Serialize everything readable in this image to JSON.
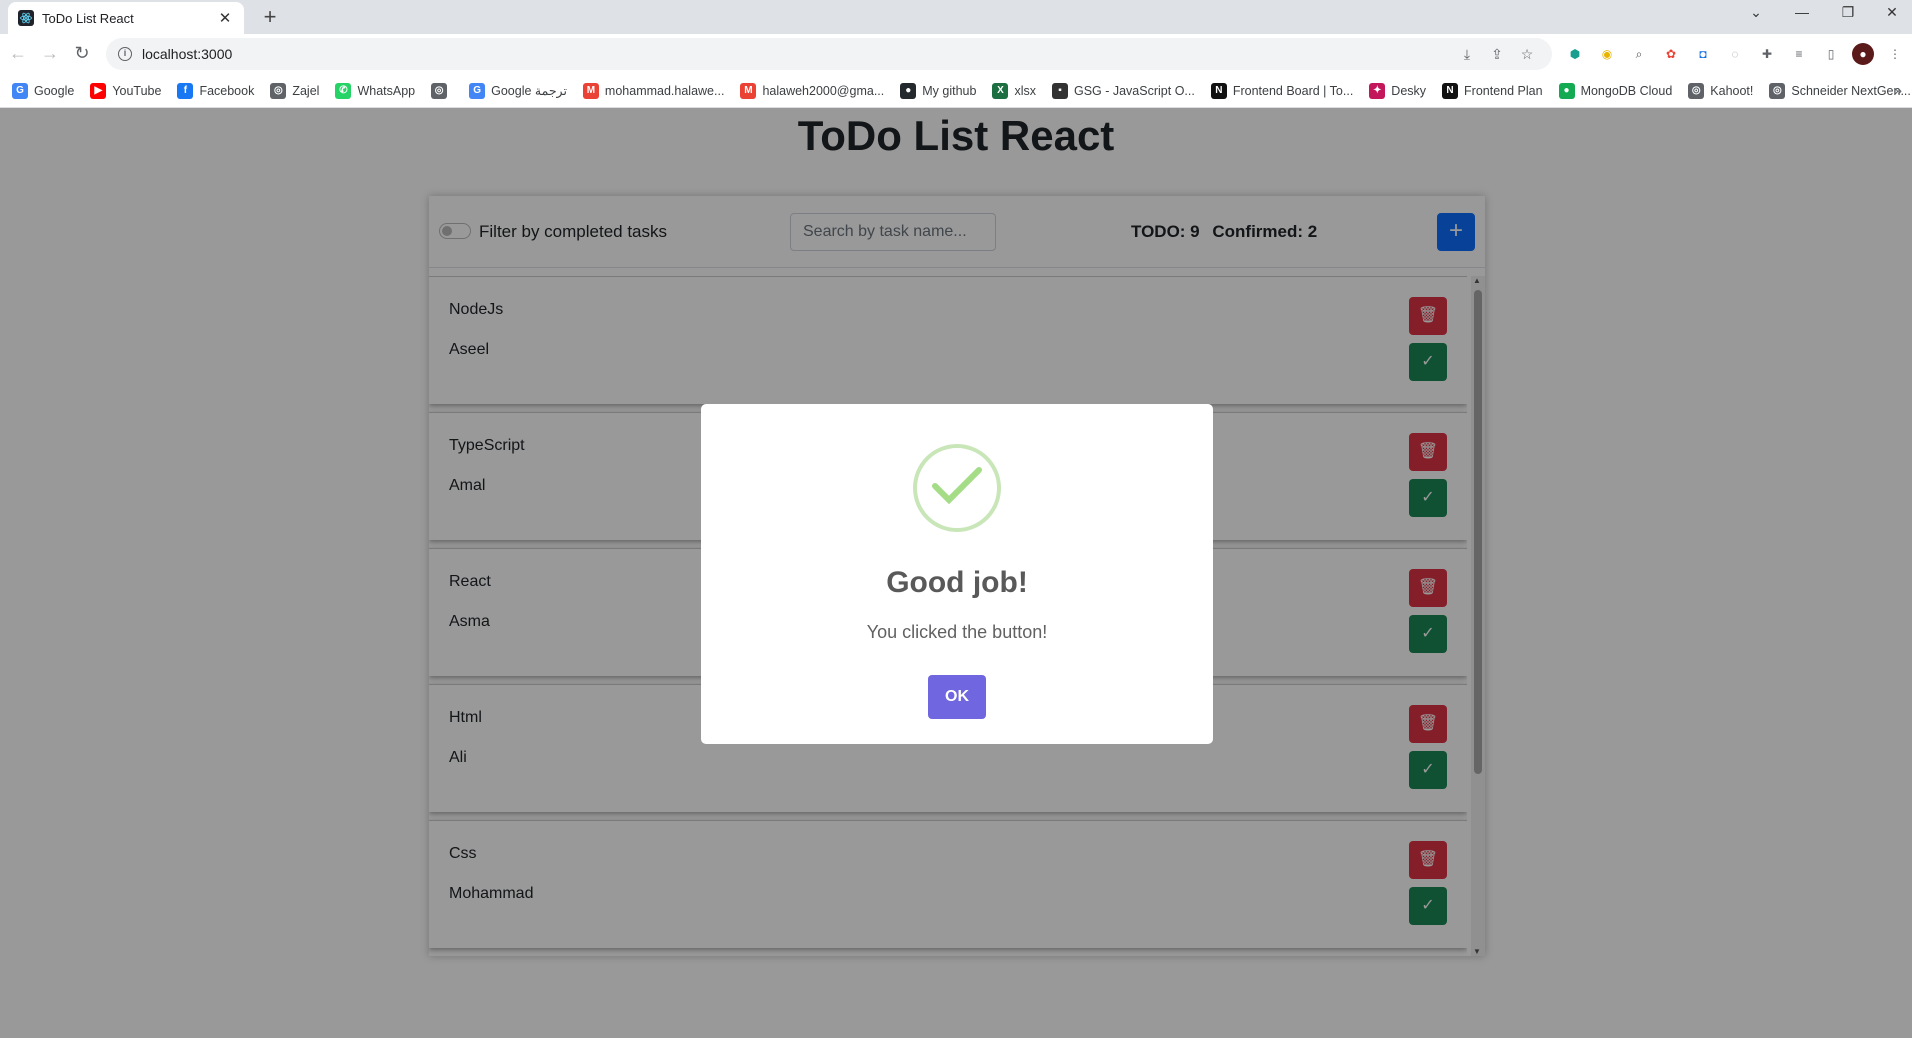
{
  "browser": {
    "tab_title": "ToDo List React",
    "url": "localhost:3000",
    "bookmarks": [
      {
        "label": "Google",
        "icon": "google-icon",
        "color": "#4285f4",
        "glyph": "G"
      },
      {
        "label": "YouTube",
        "icon": "youtube-icon",
        "color": "#ff0000",
        "glyph": "▶"
      },
      {
        "label": "Facebook",
        "icon": "facebook-icon",
        "color": "#1877f2",
        "glyph": "f"
      },
      {
        "label": "Zajel",
        "icon": "globe-icon",
        "color": "#5f6368",
        "glyph": "◎"
      },
      {
        "label": "WhatsApp",
        "icon": "whatsapp-icon",
        "color": "#25d366",
        "glyph": "✆"
      },
      {
        "label": "",
        "icon": "globe-icon",
        "color": "#5f6368",
        "glyph": "◎"
      },
      {
        "label": "Google ترجمة",
        "icon": "translate-icon",
        "color": "#4285f4",
        "glyph": "G"
      },
      {
        "label": "mohammad.halawe...",
        "icon": "gmail-icon",
        "color": "#ea4335",
        "glyph": "M"
      },
      {
        "label": "halaweh2000@gma...",
        "icon": "gmail-icon",
        "color": "#ea4335",
        "glyph": "M"
      },
      {
        "label": "My github",
        "icon": "github-icon",
        "color": "#24292e",
        "glyph": "●"
      },
      {
        "label": "xlsx",
        "icon": "excel-icon",
        "color": "#1d6f42",
        "glyph": "X"
      },
      {
        "label": "GSG - JavaScript O...",
        "icon": "document-icon",
        "color": "#333333",
        "glyph": "▪"
      },
      {
        "label": "Frontend Board | To...",
        "icon": "notion-icon",
        "color": "#111111",
        "glyph": "N"
      },
      {
        "label": "Desky",
        "icon": "desky-icon",
        "color": "#c2185b",
        "glyph": "✦"
      },
      {
        "label": "Frontend Plan",
        "icon": "notion-icon",
        "color": "#111111",
        "glyph": "N"
      },
      {
        "label": "MongoDB Cloud",
        "icon": "mongodb-icon",
        "color": "#13aa52",
        "glyph": "●"
      },
      {
        "label": "Kahoot!",
        "icon": "globe-icon",
        "color": "#5f6368",
        "glyph": "◎"
      },
      {
        "label": "Schneider NextGen...",
        "icon": "globe-icon",
        "color": "#5f6368",
        "glyph": "◎"
      }
    ]
  },
  "page": {
    "title": "ToDo List React",
    "filter_label": "Filter by completed tasks",
    "search_placeholder": "Search by task name...",
    "todo_count": "TODO: 9",
    "confirmed_count": "Confirmed: 2",
    "add_button": "+",
    "tasks": [
      {
        "name": "NodeJs",
        "assignee": "Aseel"
      },
      {
        "name": "TypeScript",
        "assignee": "Amal"
      },
      {
        "name": "React",
        "assignee": "Asma"
      },
      {
        "name": "Html",
        "assignee": "Ali"
      },
      {
        "name": "Css",
        "assignee": "Mohammad"
      }
    ]
  },
  "modal": {
    "title": "Good job!",
    "text": "You clicked the button!",
    "ok_label": "OK"
  },
  "colors": {
    "primary": "#0d6efd",
    "danger": "#dc3545",
    "success": "#198754",
    "modal_button": "#7066e0",
    "success_check": "#a5dc86"
  }
}
